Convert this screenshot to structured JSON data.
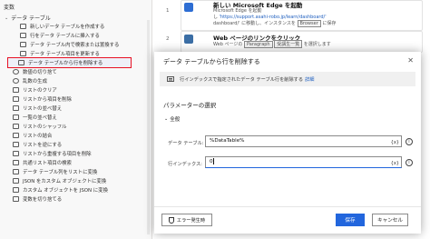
{
  "sidebar": {
    "variables_title": "変数",
    "group_title": "データ テーブル",
    "items": [
      {
        "label": "新しいデータ テーブルを作成する",
        "level": 2,
        "icon": "table-icon"
      },
      {
        "label": "行をデータ テーブルに挿入する",
        "level": 2,
        "icon": "table-icon"
      },
      {
        "label": "データ テーブル内で検索または置換する",
        "level": 2,
        "icon": "table-icon"
      },
      {
        "label": "データ テーブル項目を更新する",
        "level": 2,
        "icon": "table-icon"
      },
      {
        "label": "データ テーブルから行を削除する",
        "level": 2,
        "icon": "table-icon",
        "selected": true
      },
      {
        "label": "数値の切り捨て",
        "level": 1,
        "icon": "number-icon"
      },
      {
        "label": "乱数の生成",
        "level": 1,
        "icon": "number-icon"
      },
      {
        "label": "リストのクリア",
        "level": 1,
        "icon": "list-icon"
      },
      {
        "label": "リストから項目を削除",
        "level": 1,
        "icon": "list-icon"
      },
      {
        "label": "リストの並べ替え",
        "level": 1,
        "icon": "list-icon"
      },
      {
        "label": "一覧の並べ替え",
        "level": 1,
        "icon": "list-icon"
      },
      {
        "label": "リストのシャッフル",
        "level": 1,
        "icon": "list-icon"
      },
      {
        "label": "リストの結合",
        "level": 1,
        "icon": "list-icon"
      },
      {
        "label": "リストを逆にする",
        "level": 1,
        "icon": "list-icon"
      },
      {
        "label": "リストから重複する項目を削除",
        "level": 1,
        "icon": "list-icon"
      },
      {
        "label": "共通リスト項目の検索",
        "level": 1,
        "icon": "list-icon"
      },
      {
        "label": "データ テーブル列をリストに変換",
        "level": 1,
        "icon": "list-icon"
      },
      {
        "label": "JSON をカスタム オブジェクトに変換",
        "level": 1,
        "icon": "json-icon"
      },
      {
        "label": "カスタム オブジェクトを JSON に変換",
        "level": 1,
        "icon": "json-icon"
      },
      {
        "label": "変数を切り捨てる",
        "level": 1,
        "icon": "variable-icon"
      }
    ]
  },
  "flow": {
    "steps": [
      {
        "number": "1",
        "title": "新しい Microsoft Edge を起動",
        "sub_prefix": "Microsoft Edge を起動",
        "sub_line2_prefix": "し ",
        "url": "'https://support.asahi-robo.jp/learn/dashboard/'",
        "sub_line3_prefix": "dashboard/' に移動し、インスタンスを ",
        "chip": "Browser",
        "sub_line3_suffix": " に保存"
      },
      {
        "number": "2",
        "title": "Web ページのリンクをクリック",
        "sub_prefix": "Web ページの ",
        "chip1": "Paragraph",
        "chip2": "受講生一覧",
        "sub_suffix": " を選択します"
      }
    ]
  },
  "modal": {
    "title": "データ テーブルから行を削除する",
    "close_label": "✕",
    "info_text": "行インデックスで指定されたデータ テーブル行を削除する",
    "info_link": "詳細",
    "section_title": "パラメーターの選択",
    "subsection": "全般",
    "fields": [
      {
        "label": "データ テーブル:",
        "value": "%DataTable%",
        "fx": "{x}"
      },
      {
        "label": "行インデックス:",
        "value": "0",
        "fx": "{x}"
      }
    ],
    "error_button": "エラー発生時",
    "save_button": "保存",
    "cancel_button": "キャンセル"
  },
  "colors": {
    "accent": "#2266dd",
    "selected_outline": "#e81123"
  }
}
